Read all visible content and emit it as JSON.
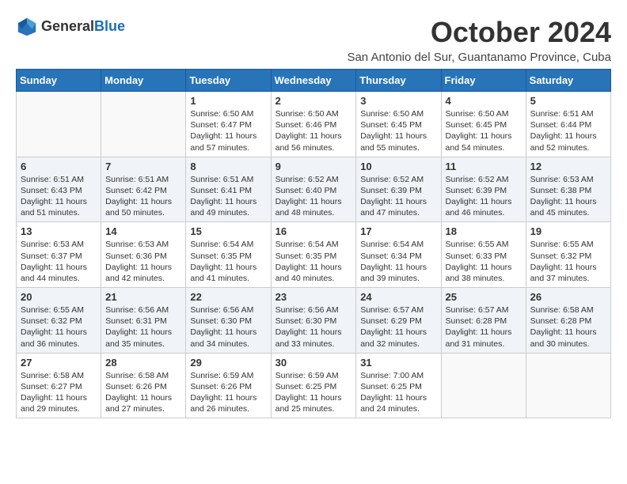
{
  "header": {
    "logo_general": "General",
    "logo_blue": "Blue",
    "month_title": "October 2024",
    "location": "San Antonio del Sur, Guantanamo Province, Cuba"
  },
  "weekdays": [
    "Sunday",
    "Monday",
    "Tuesday",
    "Wednesday",
    "Thursday",
    "Friday",
    "Saturday"
  ],
  "weeks": [
    [
      {
        "day": "",
        "sunrise": "",
        "sunset": "",
        "daylight": ""
      },
      {
        "day": "",
        "sunrise": "",
        "sunset": "",
        "daylight": ""
      },
      {
        "day": "1",
        "sunrise": "Sunrise: 6:50 AM",
        "sunset": "Sunset: 6:47 PM",
        "daylight": "Daylight: 11 hours and 57 minutes."
      },
      {
        "day": "2",
        "sunrise": "Sunrise: 6:50 AM",
        "sunset": "Sunset: 6:46 PM",
        "daylight": "Daylight: 11 hours and 56 minutes."
      },
      {
        "day": "3",
        "sunrise": "Sunrise: 6:50 AM",
        "sunset": "Sunset: 6:45 PM",
        "daylight": "Daylight: 11 hours and 55 minutes."
      },
      {
        "day": "4",
        "sunrise": "Sunrise: 6:50 AM",
        "sunset": "Sunset: 6:45 PM",
        "daylight": "Daylight: 11 hours and 54 minutes."
      },
      {
        "day": "5",
        "sunrise": "Sunrise: 6:51 AM",
        "sunset": "Sunset: 6:44 PM",
        "daylight": "Daylight: 11 hours and 52 minutes."
      }
    ],
    [
      {
        "day": "6",
        "sunrise": "Sunrise: 6:51 AM",
        "sunset": "Sunset: 6:43 PM",
        "daylight": "Daylight: 11 hours and 51 minutes."
      },
      {
        "day": "7",
        "sunrise": "Sunrise: 6:51 AM",
        "sunset": "Sunset: 6:42 PM",
        "daylight": "Daylight: 11 hours and 50 minutes."
      },
      {
        "day": "8",
        "sunrise": "Sunrise: 6:51 AM",
        "sunset": "Sunset: 6:41 PM",
        "daylight": "Daylight: 11 hours and 49 minutes."
      },
      {
        "day": "9",
        "sunrise": "Sunrise: 6:52 AM",
        "sunset": "Sunset: 6:40 PM",
        "daylight": "Daylight: 11 hours and 48 minutes."
      },
      {
        "day": "10",
        "sunrise": "Sunrise: 6:52 AM",
        "sunset": "Sunset: 6:39 PM",
        "daylight": "Daylight: 11 hours and 47 minutes."
      },
      {
        "day": "11",
        "sunrise": "Sunrise: 6:52 AM",
        "sunset": "Sunset: 6:39 PM",
        "daylight": "Daylight: 11 hours and 46 minutes."
      },
      {
        "day": "12",
        "sunrise": "Sunrise: 6:53 AM",
        "sunset": "Sunset: 6:38 PM",
        "daylight": "Daylight: 11 hours and 45 minutes."
      }
    ],
    [
      {
        "day": "13",
        "sunrise": "Sunrise: 6:53 AM",
        "sunset": "Sunset: 6:37 PM",
        "daylight": "Daylight: 11 hours and 44 minutes."
      },
      {
        "day": "14",
        "sunrise": "Sunrise: 6:53 AM",
        "sunset": "Sunset: 6:36 PM",
        "daylight": "Daylight: 11 hours and 42 minutes."
      },
      {
        "day": "15",
        "sunrise": "Sunrise: 6:54 AM",
        "sunset": "Sunset: 6:35 PM",
        "daylight": "Daylight: 11 hours and 41 minutes."
      },
      {
        "day": "16",
        "sunrise": "Sunrise: 6:54 AM",
        "sunset": "Sunset: 6:35 PM",
        "daylight": "Daylight: 11 hours and 40 minutes."
      },
      {
        "day": "17",
        "sunrise": "Sunrise: 6:54 AM",
        "sunset": "Sunset: 6:34 PM",
        "daylight": "Daylight: 11 hours and 39 minutes."
      },
      {
        "day": "18",
        "sunrise": "Sunrise: 6:55 AM",
        "sunset": "Sunset: 6:33 PM",
        "daylight": "Daylight: 11 hours and 38 minutes."
      },
      {
        "day": "19",
        "sunrise": "Sunrise: 6:55 AM",
        "sunset": "Sunset: 6:32 PM",
        "daylight": "Daylight: 11 hours and 37 minutes."
      }
    ],
    [
      {
        "day": "20",
        "sunrise": "Sunrise: 6:55 AM",
        "sunset": "Sunset: 6:32 PM",
        "daylight": "Daylight: 11 hours and 36 minutes."
      },
      {
        "day": "21",
        "sunrise": "Sunrise: 6:56 AM",
        "sunset": "Sunset: 6:31 PM",
        "daylight": "Daylight: 11 hours and 35 minutes."
      },
      {
        "day": "22",
        "sunrise": "Sunrise: 6:56 AM",
        "sunset": "Sunset: 6:30 PM",
        "daylight": "Daylight: 11 hours and 34 minutes."
      },
      {
        "day": "23",
        "sunrise": "Sunrise: 6:56 AM",
        "sunset": "Sunset: 6:30 PM",
        "daylight": "Daylight: 11 hours and 33 minutes."
      },
      {
        "day": "24",
        "sunrise": "Sunrise: 6:57 AM",
        "sunset": "Sunset: 6:29 PM",
        "daylight": "Daylight: 11 hours and 32 minutes."
      },
      {
        "day": "25",
        "sunrise": "Sunrise: 6:57 AM",
        "sunset": "Sunset: 6:28 PM",
        "daylight": "Daylight: 11 hours and 31 minutes."
      },
      {
        "day": "26",
        "sunrise": "Sunrise: 6:58 AM",
        "sunset": "Sunset: 6:28 PM",
        "daylight": "Daylight: 11 hours and 30 minutes."
      }
    ],
    [
      {
        "day": "27",
        "sunrise": "Sunrise: 6:58 AM",
        "sunset": "Sunset: 6:27 PM",
        "daylight": "Daylight: 11 hours and 29 minutes."
      },
      {
        "day": "28",
        "sunrise": "Sunrise: 6:58 AM",
        "sunset": "Sunset: 6:26 PM",
        "daylight": "Daylight: 11 hours and 27 minutes."
      },
      {
        "day": "29",
        "sunrise": "Sunrise: 6:59 AM",
        "sunset": "Sunset: 6:26 PM",
        "daylight": "Daylight: 11 hours and 26 minutes."
      },
      {
        "day": "30",
        "sunrise": "Sunrise: 6:59 AM",
        "sunset": "Sunset: 6:25 PM",
        "daylight": "Daylight: 11 hours and 25 minutes."
      },
      {
        "day": "31",
        "sunrise": "Sunrise: 7:00 AM",
        "sunset": "Sunset: 6:25 PM",
        "daylight": "Daylight: 11 hours and 24 minutes."
      },
      {
        "day": "",
        "sunrise": "",
        "sunset": "",
        "daylight": ""
      },
      {
        "day": "",
        "sunrise": "",
        "sunset": "",
        "daylight": ""
      }
    ]
  ]
}
